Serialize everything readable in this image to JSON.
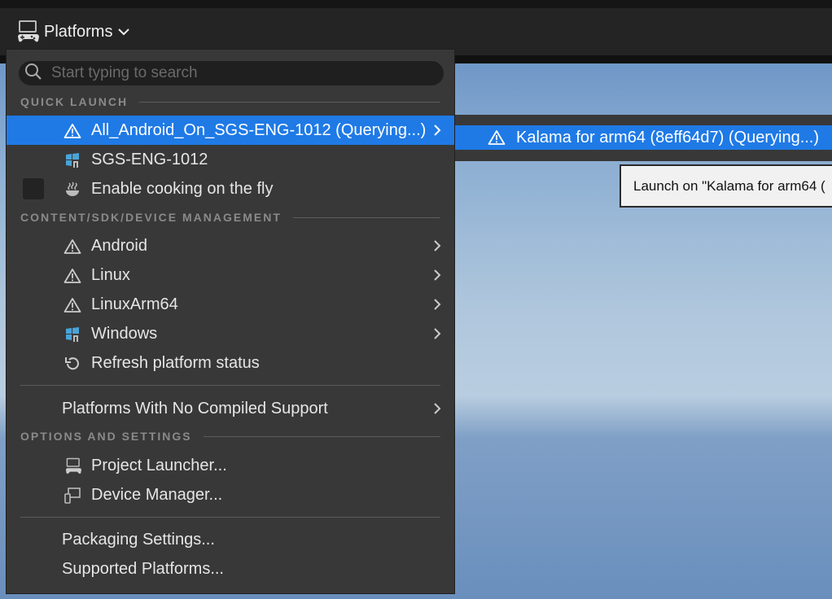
{
  "toolbar": {
    "platforms_label": "Platforms"
  },
  "search": {
    "placeholder": "Start typing to search"
  },
  "sections": {
    "quick_launch": "QUICK LAUNCH",
    "content_mgmt": "CONTENT/SDK/DEVICE MANAGEMENT",
    "options": "OPTIONS AND SETTINGS"
  },
  "quick_launch": {
    "android_all": "All_Android_On_SGS-ENG-1012 (Querying...)",
    "host": "SGS-ENG-1012",
    "cook_on_fly": "Enable cooking on the fly"
  },
  "management": {
    "android": "Android",
    "linux": "Linux",
    "linuxarm64": "LinuxArm64",
    "windows": "Windows",
    "refresh": "Refresh platform status"
  },
  "no_compiled": "Platforms With No Compiled Support",
  "options": {
    "project_launcher": "Project Launcher...",
    "device_manager": "Device Manager..."
  },
  "footer": {
    "packaging": "Packaging Settings...",
    "supported": "Supported Platforms..."
  },
  "submenu": {
    "device": "Kalama for arm64 (8eff64d7) (Querying...)"
  },
  "tooltip": {
    "text": "Launch on \"Kalama for arm64 ("
  },
  "colors": {
    "accent": "#1f7ae6",
    "menu_bg": "#383838",
    "windows_icon": "#4aa3d8"
  },
  "icons": [
    "gamepad-monitor-icon",
    "chevron-down-icon",
    "search-icon",
    "warning-icon",
    "windows-platform-icon",
    "steam-bowl-icon",
    "refresh-icon",
    "chevron-right-icon",
    "device-manager-icon"
  ]
}
